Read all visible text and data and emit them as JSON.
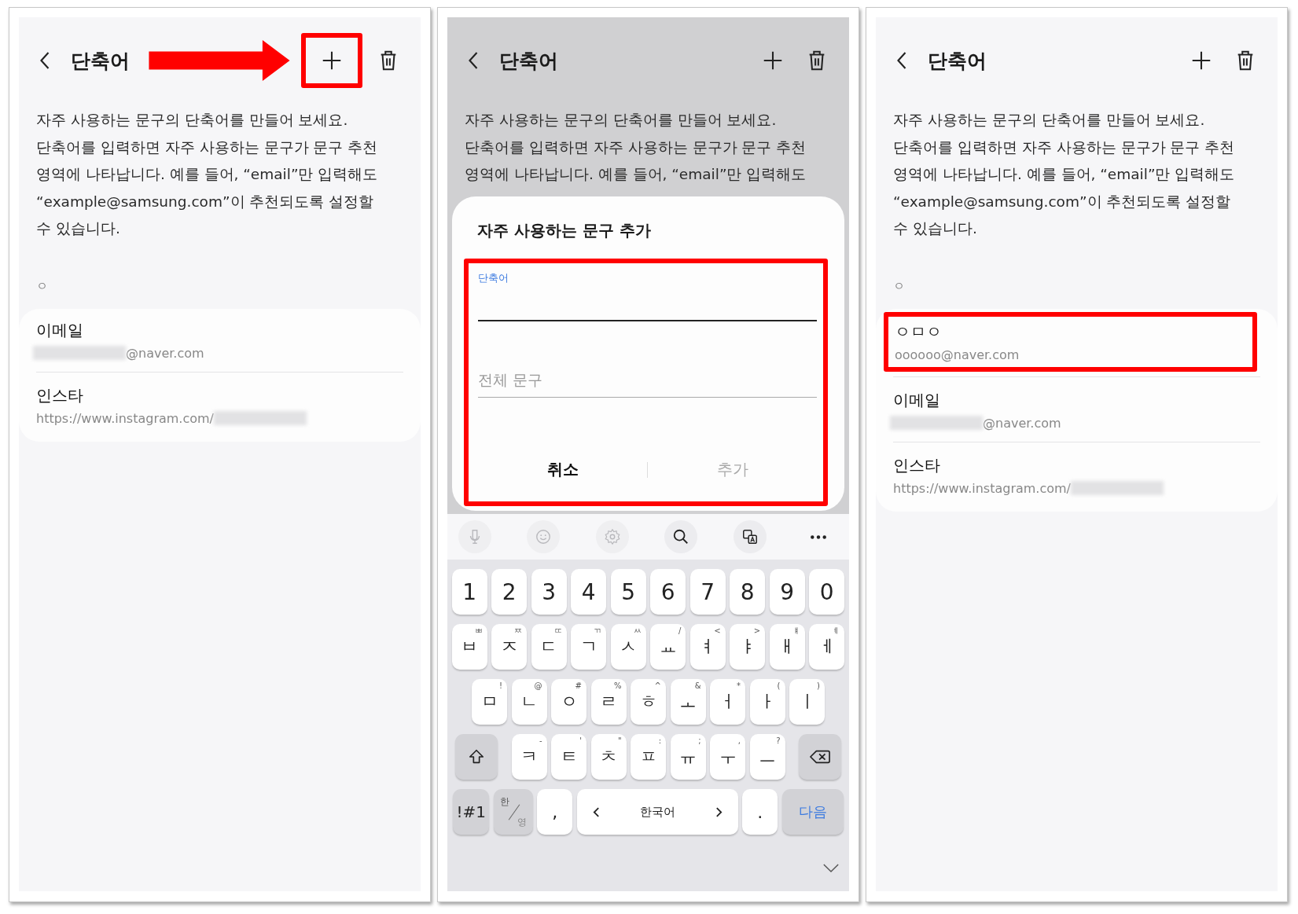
{
  "panels": [
    {
      "kind": "list",
      "header": {
        "title": "단축어",
        "actions": [
          {
            "kind": "add",
            "highlighted": true,
            "pointer_arrow": true
          },
          {
            "kind": "delete",
            "highlighted": false,
            "pointer_arrow": false
          }
        ]
      },
      "description": [
        "자주 사용하는 문구의 단축어를 만들어 보세요.",
        "단축어를 입력하면 자주 사용하는 문구가 문구 추천",
        "영역에 나타납니다. 예를 들어, “email”만 입력해도",
        "“example@samsung.com”이 추천되도록 설정할",
        "수 있습니다."
      ],
      "section_header": "ㅇ",
      "items": [
        {
          "title": "이메일",
          "subtitle": "@naver.com",
          "blur_before": true,
          "blur_after": false,
          "highlighted": false
        },
        {
          "title": "인스타",
          "subtitle": "https://www.instagram.com/",
          "blur_before": false,
          "blur_after": true,
          "highlighted": false
        }
      ]
    },
    {
      "kind": "dialog",
      "header": {
        "title": "단축어",
        "actions": [
          {
            "kind": "add",
            "highlighted": false,
            "pointer_arrow": false
          },
          {
            "kind": "delete",
            "highlighted": false,
            "pointer_arrow": false
          }
        ]
      },
      "description": [
        "자주 사용하는 문구의 단축어를 만들어 보세요.",
        "단축어를 입력하면 자주 사용하는 문구가 문구 추천",
        "영역에 나타납니다. 예를 들어, “email”만 입력해도"
      ],
      "dialog": {
        "title": "자주 사용하는 문구 추가",
        "highlighted": true,
        "fields": [
          {
            "label": "단축어",
            "focused": true
          },
          {
            "placeholder": "전체 문구",
            "focused": false
          }
        ],
        "buttons": [
          {
            "label": "취소",
            "disabled": false
          },
          {
            "label": "추가",
            "disabled": true
          }
        ]
      },
      "keyboard": {
        "toolbar": [
          {
            "kind": "mic",
            "disabled": true
          },
          {
            "kind": "emoji",
            "disabled": true
          },
          {
            "kind": "settings",
            "disabled": true
          },
          {
            "kind": "search",
            "disabled": false
          },
          {
            "kind": "translate",
            "disabled": false
          },
          {
            "kind": "more",
            "disabled": false
          }
        ],
        "rows": [
          [
            {
              "kind": "digit",
              "label": "1"
            },
            {
              "kind": "digit",
              "label": "2"
            },
            {
              "kind": "digit",
              "label": "3"
            },
            {
              "kind": "digit",
              "label": "4"
            },
            {
              "kind": "digit",
              "label": "5"
            },
            {
              "kind": "digit",
              "label": "6"
            },
            {
              "kind": "digit",
              "label": "7"
            },
            {
              "kind": "digit",
              "label": "8"
            },
            {
              "kind": "digit",
              "label": "9"
            },
            {
              "kind": "digit",
              "label": "0"
            }
          ],
          [
            {
              "kind": "char",
              "label": "ㅂ",
              "hint": "ㅃ"
            },
            {
              "kind": "char",
              "label": "ㅈ",
              "hint": "ㅉ"
            },
            {
              "kind": "char",
              "label": "ㄷ",
              "hint": "ㄸ"
            },
            {
              "kind": "char",
              "label": "ㄱ",
              "hint": "ㄲ"
            },
            {
              "kind": "char",
              "label": "ㅅ",
              "hint": "ㅆ"
            },
            {
              "kind": "char",
              "label": "ㅛ",
              "hint": "/"
            },
            {
              "kind": "char",
              "label": "ㅕ",
              "hint": "<"
            },
            {
              "kind": "char",
              "label": "ㅑ",
              "hint": ">"
            },
            {
              "kind": "char",
              "label": "ㅐ",
              "hint": "ㅒ"
            },
            {
              "kind": "char",
              "label": "ㅔ",
              "hint": "ㅖ"
            }
          ],
          [
            {
              "kind": "char",
              "label": "ㅁ",
              "hint": "!"
            },
            {
              "kind": "char",
              "label": "ㄴ",
              "hint": "@"
            },
            {
              "kind": "char",
              "label": "ㅇ",
              "hint": "#"
            },
            {
              "kind": "char",
              "label": "ㄹ",
              "hint": "%"
            },
            {
              "kind": "char",
              "label": "ㅎ",
              "hint": "^"
            },
            {
              "kind": "char",
              "label": "ㅗ",
              "hint": "&"
            },
            {
              "kind": "char",
              "label": "ㅓ",
              "hint": "*"
            },
            {
              "kind": "char",
              "label": "ㅏ",
              "hint": "("
            },
            {
              "kind": "char",
              "label": "ㅣ",
              "hint": ")"
            }
          ],
          [
            {
              "kind": "shift"
            },
            {
              "kind": "char",
              "label": "ㅋ",
              "hint": "-"
            },
            {
              "kind": "char",
              "label": "ㅌ",
              "hint": "'"
            },
            {
              "kind": "char",
              "label": "ㅊ",
              "hint": "\""
            },
            {
              "kind": "char",
              "label": "ㅍ",
              "hint": ":"
            },
            {
              "kind": "char",
              "label": "ㅠ",
              "hint": ";"
            },
            {
              "kind": "char",
              "label": "ㅜ",
              "hint": ","
            },
            {
              "kind": "char",
              "label": "ㅡ",
              "hint": "?"
            },
            {
              "kind": "backspace"
            }
          ],
          [
            {
              "kind": "symbols",
              "label": "!#1"
            },
            {
              "kind": "lang",
              "label": "한",
              "sub": "영"
            },
            {
              "kind": "char",
              "label": ","
            },
            {
              "kind": "space",
              "label": "한국어"
            },
            {
              "kind": "char",
              "label": "."
            },
            {
              "kind": "action",
              "label": "다음"
            }
          ]
        ]
      }
    },
    {
      "kind": "list",
      "header": {
        "title": "단축어",
        "actions": [
          {
            "kind": "add",
            "highlighted": false,
            "pointer_arrow": false
          },
          {
            "kind": "delete",
            "highlighted": false,
            "pointer_arrow": false
          }
        ]
      },
      "description": [
        "자주 사용하는 문구의 단축어를 만들어 보세요.",
        "단축어를 입력하면 자주 사용하는 문구가 문구 추천",
        "영역에 나타납니다. 예를 들어, “email”만 입력해도",
        "“example@samsung.com”이 추천되도록 설정할",
        "수 있습니다."
      ],
      "section_header": "ㅇ",
      "items": [
        {
          "title": "ㅇㅁㅇ",
          "subtitle": "oooooo@naver.com",
          "blur_before": false,
          "blur_after": false,
          "highlighted": true
        },
        {
          "title": "이메일",
          "subtitle": "@naver.com",
          "blur_before": true,
          "blur_after": false,
          "highlighted": false
        },
        {
          "title": "인스타",
          "subtitle": "https://www.instagram.com/",
          "blur_before": false,
          "blur_after": true,
          "highlighted": false
        }
      ]
    }
  ]
}
